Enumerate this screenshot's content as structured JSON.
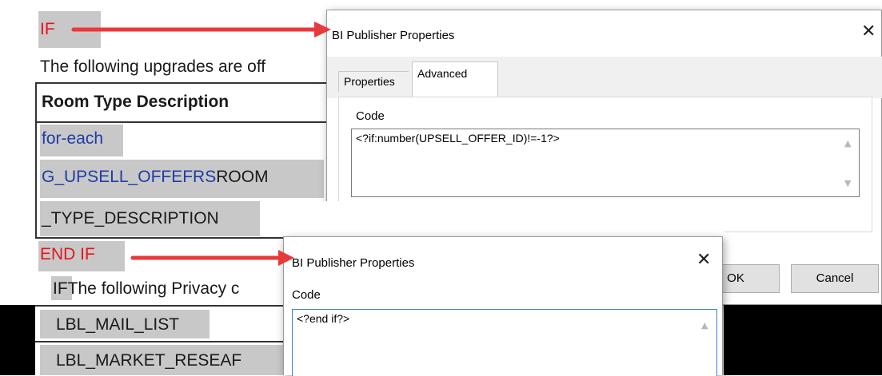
{
  "document": {
    "if_marker": "IF",
    "upgrades_text": "The following upgrades are off",
    "table_header": "Room Type Description",
    "for_each": "for-each",
    "group_field": "G_UPSELL_OFFEFRS",
    "room_field": "ROOM",
    "type_desc": "_TYPE_DESCRIPTION",
    "end_if": "END IF",
    "if_prefix": "IF",
    "privacy_text": "The following Privacy c",
    "mail_list": "LBL_MAIL_LIST",
    "market_research": "LBL_MARKET_RESEAF"
  },
  "dialog_main": {
    "title": "BI Publisher Properties",
    "tabs": [
      "Properties",
      "Advanced"
    ],
    "active_tab": "Advanced",
    "code_label": "Code",
    "code_value": "<?if:number(UPSELL_OFFER_ID)!=-1?>",
    "ok_label": "OK",
    "cancel_label": "Cancel"
  },
  "dialog_secondary": {
    "title": "BI Publisher Properties",
    "code_label": "Code",
    "code_value": "<?end if?>"
  },
  "icons": {
    "close": "close-icon",
    "scroll_up": "scroll-up-icon",
    "scroll_down": "scroll-down-icon",
    "arrow": "red-arrow"
  },
  "colors": {
    "red_text": "#e8131b",
    "blue_text": "#1f3ca6",
    "field_shading": "#c8c8c8",
    "arrow": "#e8393b",
    "focus_border": "#3c7fd1"
  }
}
